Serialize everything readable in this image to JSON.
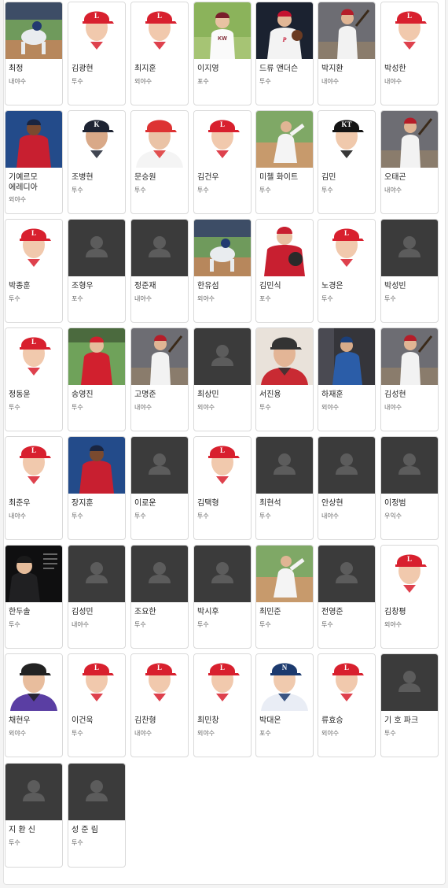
{
  "players": [
    {
      "name": "최정",
      "position": "내야수",
      "photo": "player-photo-fielding"
    },
    {
      "name": "김광현",
      "position": "투수",
      "photo": "player-photo-landers-cap"
    },
    {
      "name": "최지훈",
      "position": "외야수",
      "photo": "player-photo-landers-cap"
    },
    {
      "name": "이지영",
      "position": "포수",
      "photo": "player-photo-kiwoom"
    },
    {
      "name": "드류 앤더슨",
      "position": "투수",
      "photo": "player-photo-phillies"
    },
    {
      "name": "박지환",
      "position": "내야수",
      "photo": "player-photo-batting-dark"
    },
    {
      "name": "박성한",
      "position": "내야수",
      "photo": "player-photo-landers-cap"
    },
    {
      "name": "기예르모 에레디아",
      "position": "외야수",
      "photo": "player-photo-blue-red"
    },
    {
      "name": "조병현",
      "position": "투수",
      "photo": "player-photo-dark-cap"
    },
    {
      "name": "문승원",
      "position": "투수",
      "photo": "player-photo-white-uniform"
    },
    {
      "name": "김건우",
      "position": "투수",
      "photo": "player-photo-landers-cap"
    },
    {
      "name": "미첼 화이트",
      "position": "투수",
      "photo": "player-photo-pitching-field"
    },
    {
      "name": "김민",
      "position": "투수",
      "photo": "player-photo-kt-cap"
    },
    {
      "name": "오태곤",
      "position": "내야수",
      "photo": "player-photo-batting-dark"
    },
    {
      "name": "박종훈",
      "position": "투수",
      "photo": "player-photo-landers-cap"
    },
    {
      "name": "조형우",
      "position": "포수",
      "photo": "placeholder"
    },
    {
      "name": "정준재",
      "position": "내야수",
      "photo": "placeholder"
    },
    {
      "name": "한유섬",
      "position": "외야수",
      "photo": "player-photo-fielding"
    },
    {
      "name": "김민식",
      "position": "포수",
      "photo": "player-photo-red-gear"
    },
    {
      "name": "노경은",
      "position": "투수",
      "photo": "player-photo-landers-cap"
    },
    {
      "name": "박성빈",
      "position": "투수",
      "photo": "placeholder"
    },
    {
      "name": "정동윤",
      "position": "투수",
      "photo": "player-photo-landers-cap"
    },
    {
      "name": "송영진",
      "position": "투수",
      "photo": "player-photo-red-field"
    },
    {
      "name": "고명준",
      "position": "내야수",
      "photo": "player-photo-batting-dark"
    },
    {
      "name": "최상민",
      "position": "외야수",
      "photo": "placeholder"
    },
    {
      "name": "서진용",
      "position": "투수",
      "photo": "player-photo-closeup"
    },
    {
      "name": "하재훈",
      "position": "외야수",
      "photo": "player-photo-blue-jays"
    },
    {
      "name": "김성현",
      "position": "내야수",
      "photo": "player-photo-batting-dark"
    },
    {
      "name": "최준우",
      "position": "내야수",
      "photo": "player-photo-landers-cap"
    },
    {
      "name": "장지훈",
      "position": "투수",
      "photo": "player-photo-blue-red"
    },
    {
      "name": "이로운",
      "position": "투수",
      "photo": "placeholder"
    },
    {
      "name": "김택형",
      "position": "투수",
      "photo": "player-photo-landers-cap"
    },
    {
      "name": "최현석",
      "position": "투수",
      "photo": "placeholder"
    },
    {
      "name": "안상현",
      "position": "내야수",
      "photo": "placeholder"
    },
    {
      "name": "이정범",
      "position": "우익수",
      "photo": "placeholder"
    },
    {
      "name": "한두솔",
      "position": "투수",
      "photo": "player-photo-dark-card"
    },
    {
      "name": "김성민",
      "position": "내야수",
      "photo": "placeholder"
    },
    {
      "name": "조요한",
      "position": "투수",
      "photo": "placeholder"
    },
    {
      "name": "박시후",
      "position": "투수",
      "photo": "placeholder"
    },
    {
      "name": "최민준",
      "position": "투수",
      "photo": "player-photo-pitching-field"
    },
    {
      "name": "전영준",
      "position": "투수",
      "photo": "placeholder"
    },
    {
      "name": "김창평",
      "position": "외야수",
      "photo": "player-photo-landers-cap"
    },
    {
      "name": "채현우",
      "position": "외야수",
      "photo": "player-photo-purple"
    },
    {
      "name": "이건욱",
      "position": "투수",
      "photo": "player-photo-landers-cap"
    },
    {
      "name": "김찬형",
      "position": "내야수",
      "photo": "player-photo-landers-cap"
    },
    {
      "name": "최민창",
      "position": "외야수",
      "photo": "player-photo-landers-cap"
    },
    {
      "name": "박대온",
      "position": "포수",
      "photo": "player-photo-nc-cap"
    },
    {
      "name": "류효승",
      "position": "외야수",
      "photo": "player-photo-landers-cap"
    },
    {
      "name": "기 호 파크",
      "position": "투수",
      "photo": "placeholder"
    },
    {
      "name": "지 환 신",
      "position": "투수",
      "photo": "placeholder"
    },
    {
      "name": "성 준 림",
      "position": "투수",
      "photo": "placeholder"
    }
  ],
  "colors": {
    "landers_red": "#d8202e",
    "placeholder_bg": "#3b3b3b",
    "placeholder_icon": "#5c5c5c"
  }
}
